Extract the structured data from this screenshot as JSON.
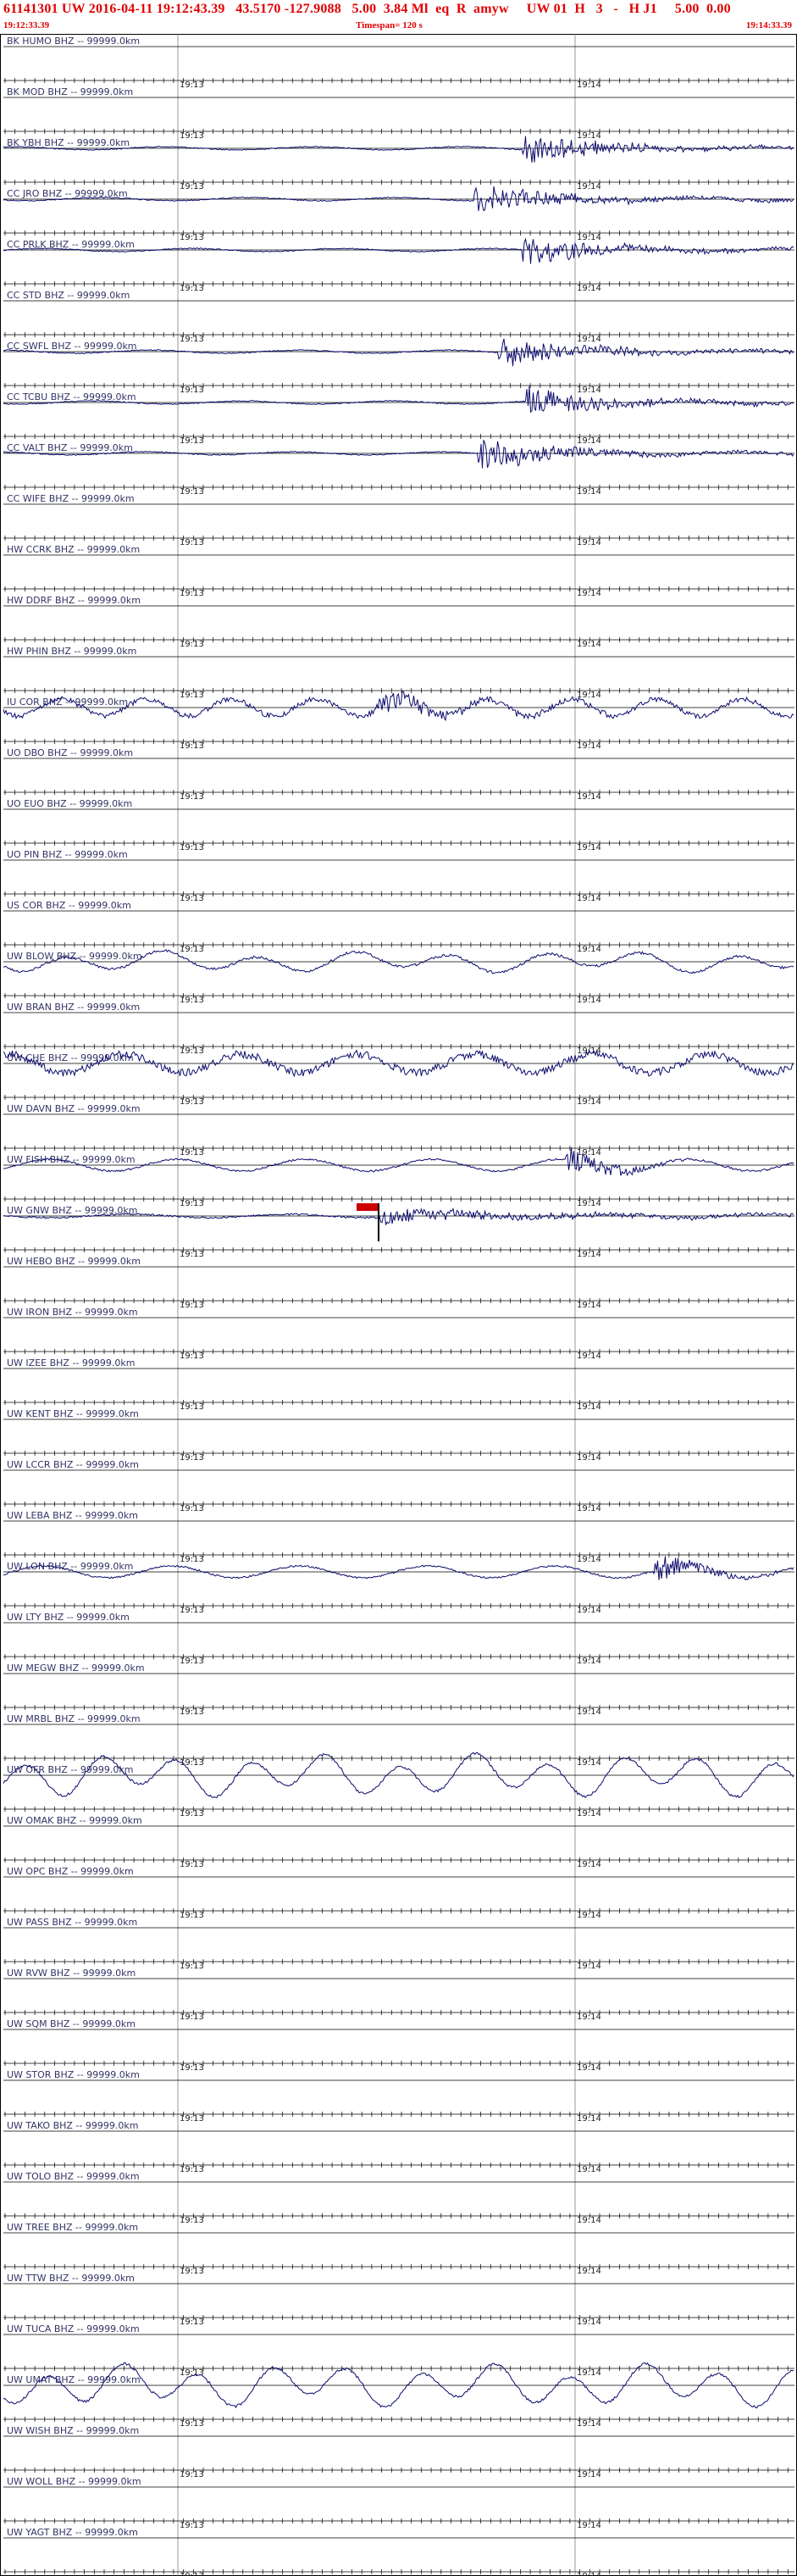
{
  "header": {
    "title": "61141301 UW 2016-04-11 19:12:43.39   43.5170 -127.9088   5.00  3.84 Ml  eq  R  amyw     UW 01  H   3   -   H J1     5.00  0.00",
    "start_time": "19:12:33.39",
    "timespan": "Timespan= 120 s",
    "end_time": "19:14:33.39"
  },
  "time_marks": [
    "19:13",
    "19:14"
  ],
  "colors": {
    "trace": "#0b0b6e",
    "axis": "#000000",
    "label": "#333366",
    "header_text": "#e00000",
    "pick_marker": "#cc0000"
  },
  "channels": [
    {
      "label": "BK HUMO BHZ -- 99999.0km",
      "active": false
    },
    {
      "label": "BK MOD BHZ -- 99999.0km",
      "active": false
    },
    {
      "label": "BK YBH BHZ -- 99999.0km",
      "active": true,
      "onset": 0.655,
      "style": "burst"
    },
    {
      "label": "CC JRO BHZ -- 99999.0km",
      "active": true,
      "onset": 0.595,
      "style": "burst"
    },
    {
      "label": "CC PRLK BHZ -- 99999.0km",
      "active": true,
      "onset": 0.655,
      "style": "burst"
    },
    {
      "label": "CC STD BHZ -- 99999.0km",
      "active": false
    },
    {
      "label": "CC SWFL BHZ -- 99999.0km",
      "active": true,
      "onset": 0.625,
      "style": "burst"
    },
    {
      "label": "CC TCBU BHZ -- 99999.0km",
      "active": true,
      "onset": 0.66,
      "style": "burst"
    },
    {
      "label": "CC VALT BHZ -- 99999.0km",
      "active": true,
      "onset": 0.6,
      "style": "burst"
    },
    {
      "label": "CC WIFE BHZ -- 99999.0km",
      "active": false
    },
    {
      "label": "HW CCRK BHZ -- 99999.0km",
      "active": false
    },
    {
      "label": "HW DDRF BHZ -- 99999.0km",
      "active": false
    },
    {
      "label": "HW PHIN BHZ -- 99999.0km",
      "active": false
    },
    {
      "label": "IU COR BHZ -- 99999.0km",
      "active": true,
      "onset": 0.47,
      "style": "noisy"
    },
    {
      "label": "UO DBO BHZ -- 99999.0km",
      "active": false
    },
    {
      "label": "UO EUO BHZ -- 99999.0km",
      "active": false
    },
    {
      "label": "UO PIN BHZ -- 99999.0km",
      "active": false
    },
    {
      "label": "US COR BHZ -- 99999.0km",
      "active": false
    },
    {
      "label": "UW BLOW BHZ -- 99999.0km",
      "active": true,
      "style": "wave"
    },
    {
      "label": "UW BRAN BHZ -- 99999.0km",
      "active": false
    },
    {
      "label": "UW CHE BHZ -- 99999.0km",
      "active": true,
      "style": "fuzzy"
    },
    {
      "label": "UW DAVN BHZ -- 99999.0km",
      "active": false
    },
    {
      "label": "UW FISH BHZ -- 99999.0km",
      "active": true,
      "onset": 0.71,
      "style": "wave-burst"
    },
    {
      "label": "UW GNW BHZ -- 99999.0km",
      "active": true,
      "onset": 0.475,
      "style": "pick"
    },
    {
      "label": "UW HEBO BHZ -- 99999.0km",
      "active": false
    },
    {
      "label": "UW IRON BHZ -- 99999.0km",
      "active": false
    },
    {
      "label": "UW IZEE BHZ -- 99999.0km",
      "active": false
    },
    {
      "label": "UW KENT BHZ -- 99999.0km",
      "active": false
    },
    {
      "label": "UW LCCR BHZ -- 99999.0km",
      "active": false
    },
    {
      "label": "UW LEBA BHZ -- 99999.0km",
      "active": false
    },
    {
      "label": "UW LON BHZ -- 99999.0km",
      "active": true,
      "onset": 0.82,
      "style": "wave-burst"
    },
    {
      "label": "UW LTY BHZ -- 99999.0km",
      "active": false
    },
    {
      "label": "UW MEGW BHZ -- 99999.0km",
      "active": false
    },
    {
      "label": "UW MRBL BHZ -- 99999.0km",
      "active": false
    },
    {
      "label": "UW OFR BHZ -- 99999.0km",
      "active": true,
      "style": "bigwave"
    },
    {
      "label": "UW OMAK BHZ -- 99999.0km",
      "active": false
    },
    {
      "label": "UW OPC BHZ -- 99999.0km",
      "active": false
    },
    {
      "label": "UW PASS BHZ -- 99999.0km",
      "active": false
    },
    {
      "label": "UW RVW BHZ -- 99999.0km",
      "active": false
    },
    {
      "label": "UW SQM BHZ -- 99999.0km",
      "active": false
    },
    {
      "label": "UW STOR BHZ -- 99999.0km",
      "active": false
    },
    {
      "label": "UW TAKO BHZ -- 99999.0km",
      "active": false
    },
    {
      "label": "UW TOLO BHZ -- 99999.0km",
      "active": false
    },
    {
      "label": "UW TREE BHZ -- 99999.0km",
      "active": false
    },
    {
      "label": "UW TTW BHZ -- 99999.0km",
      "active": false
    },
    {
      "label": "UW TUCA BHZ -- 99999.0km",
      "active": false
    },
    {
      "label": "UW UMAT BHZ -- 99999.0km",
      "active": true,
      "style": "bigwave"
    },
    {
      "label": "UW WISH BHZ -- 99999.0km",
      "active": false
    },
    {
      "label": "UW WOLL BHZ -- 99999.0km",
      "active": false
    },
    {
      "label": "UW YAGT BHZ -- 99999.0km",
      "active": false
    }
  ]
}
